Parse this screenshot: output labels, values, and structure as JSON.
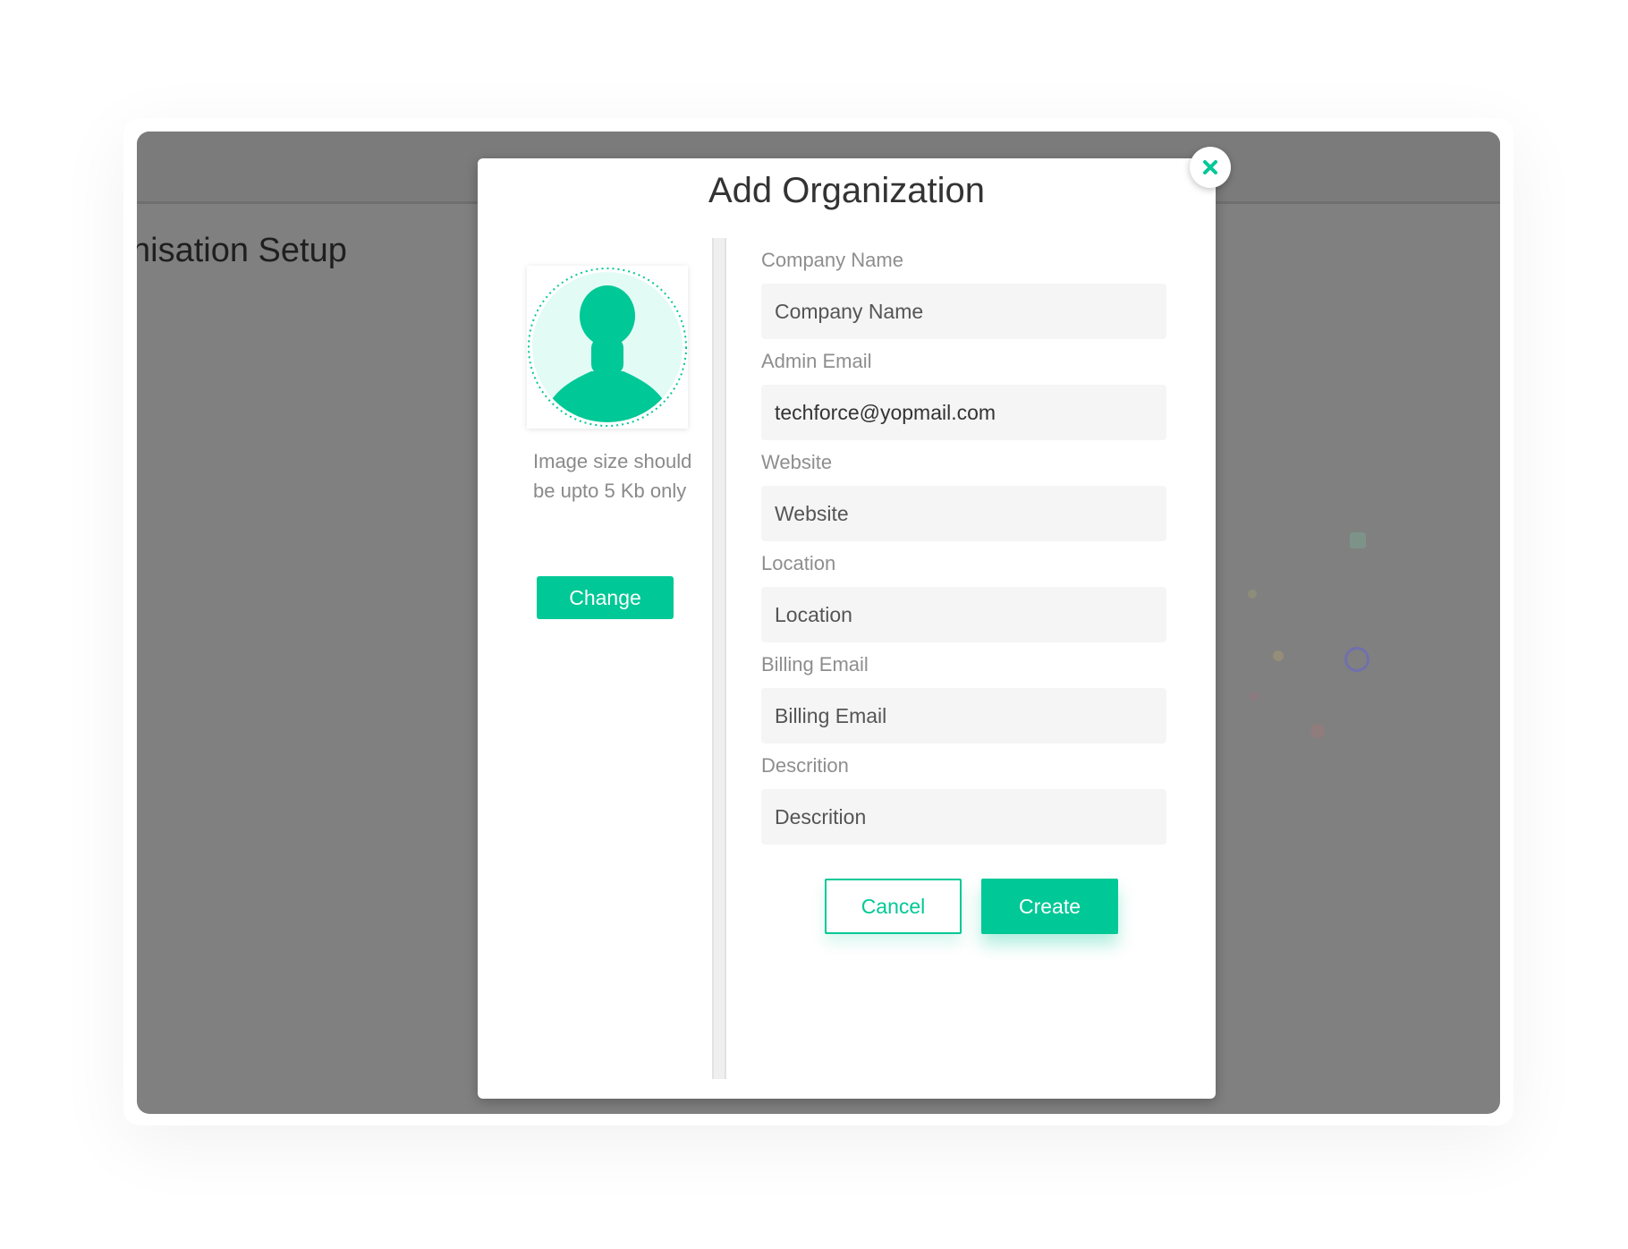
{
  "background_page": {
    "title": "nisation Setup"
  },
  "modal": {
    "title": "Add Organization",
    "close_icon": "close-x-icon",
    "avatar_icon": "user-silhouette-icon",
    "image_hint": "Image size should be upto 5 Kb only",
    "change_label": "Change",
    "fields": [
      {
        "label": "Company Name",
        "placeholder": "Company Name",
        "value": ""
      },
      {
        "label": "Admin Email",
        "placeholder": "Admin Email",
        "value": "techforce@yopmail.com"
      },
      {
        "label": "Website",
        "placeholder": "Website",
        "value": ""
      },
      {
        "label": "Location",
        "placeholder": "Location",
        "value": ""
      },
      {
        "label": "Billing Email",
        "placeholder": "Billing Email",
        "value": ""
      },
      {
        "label": "Descrition",
        "placeholder": "Descrition",
        "value": ""
      }
    ],
    "cancel_label": "Cancel",
    "create_label": "Create"
  },
  "colors": {
    "accent": "#00c896",
    "overlay": "#808080",
    "avatar_bg": "#e3fbf5"
  }
}
